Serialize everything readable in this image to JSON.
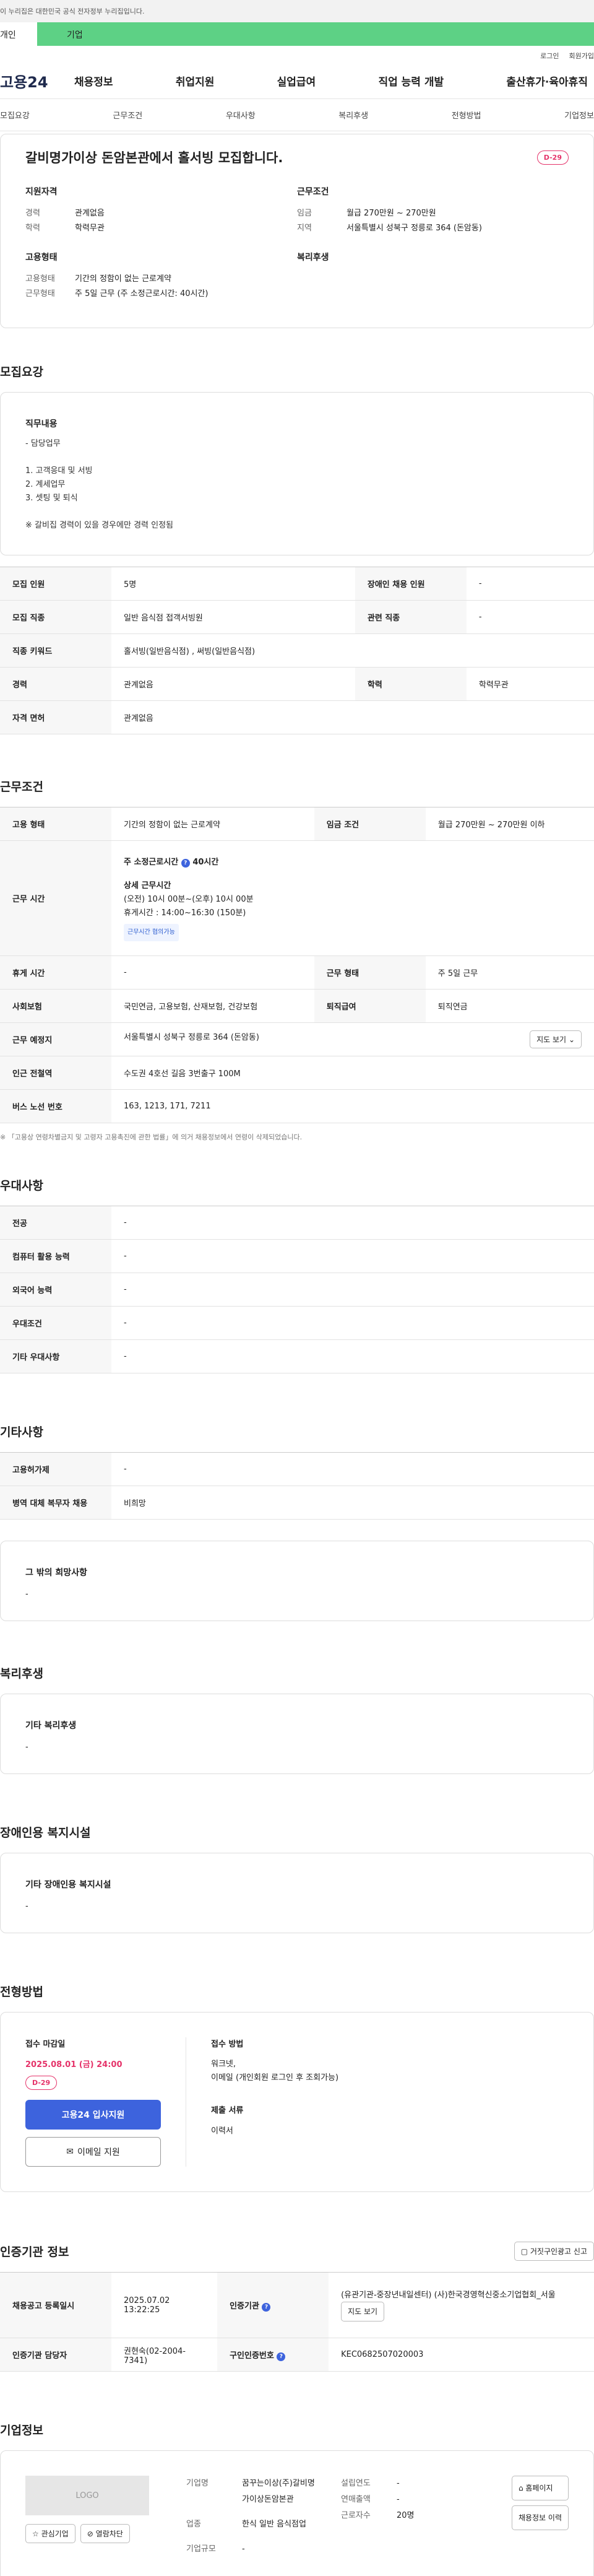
{
  "header": {
    "gov_banner": "이 누리집은 대한민국 공식 전자정부 누리집입니다.",
    "segment": [
      "개인",
      "기업"
    ],
    "util": [
      "로그인",
      "회원가입"
    ],
    "logo": "고용24",
    "gnb": [
      "채용정보",
      "취업지원",
      "실업급여",
      "직업 능력 개발",
      "출산휴가·육아휴직"
    ],
    "anchors": [
      "모집요강",
      "근무조건",
      "우대사항",
      "복리후생",
      "전형방법",
      "기업정보"
    ]
  },
  "summary": {
    "title": "갈비명가이상 돈암본관에서 홀서빙 모집합니다.",
    "dday": "D-29",
    "qual_head": "지원자격",
    "career_k": "경력",
    "career_v": "관계없음",
    "edu_k": "학력",
    "edu_v": "학력무관",
    "cond_head": "근무조건",
    "wage_k": "임금",
    "wage_v": "월급 270만원 ~ 270만원",
    "area_k": "지역",
    "area_v": "서울특별시 성북구 정릉로 364 (돈암동)",
    "emp_head": "고용형태",
    "emptype_k": "고용형태",
    "emptype_v": "기간의 정함이 없는 근로계약",
    "hours_k": "근무형태",
    "hours_v": "주 5일 근무 (주 소정근로시간: 40시간)",
    "welfare_head": "복리후생"
  },
  "recruit": {
    "title": "모집요강",
    "duty_head": "직무내용",
    "duty_lines": [
      "- 담당업무",
      "",
      "1. 고객응대 및 서빙",
      "2. 계세업무",
      "3. 셋팅 및 퇴식",
      "",
      "※ 갈비집 경력이 있을 경우에만 경력 인정됨"
    ],
    "rows": [
      {
        "k1": "모집 인원",
        "v1": "5명",
        "k2": "장애인 채용 인원",
        "v2": "-"
      },
      {
        "k1": "모집 직종",
        "v1": "일반 음식점 접객서빙원",
        "k2": "관련 직종",
        "v2": "-"
      },
      {
        "k1": "직종 키워드",
        "v1": "홀서빙(일반음식점) , 써빙(일반음식점)",
        "k2": "",
        "v2": ""
      },
      {
        "k1": "경력",
        "v1": "관계없음",
        "k2": "학력",
        "v2": "학력무관"
      },
      {
        "k1": "자격 면허",
        "v1": "관계없음",
        "k2": "",
        "v2": ""
      }
    ]
  },
  "work": {
    "title": "근무조건",
    "emp_k": "고용 형태",
    "emp_v": "기간의 정함이 없는 근로계약",
    "wage_k": "임금 조건",
    "wage_v": "월급 270만원 ~ 270만원 이하",
    "time_k": "근무 시간",
    "time_main": "주 소정근로시간",
    "time_hours": "40시간",
    "time_detail_head": "상세 근무시간",
    "time_detail_1": "(오전) 10시 00분~(오후) 10시 00분",
    "time_detail_2": "휴게시간 :  14:00~16:30 (150분)",
    "time_chip": "근무시간 협의가능",
    "rest_k": "휴게 시간",
    "rest_v": "-",
    "form_k": "근무 형태",
    "form_v": "주 5일 근무",
    "ins_k": "사회보험",
    "ins_v": "국민연금, 고용보험, 산재보험, 건강보험",
    "ret_k": "퇴직급여",
    "ret_v": "퇴직연금",
    "place_k": "근무 예정지",
    "place_v": "서울특별시 성북구 정릉로 364 (돈암동)",
    "map_btn": "지도 보기",
    "subway_k": "인근 전철역",
    "subway_v": "수도권 4호선 길음 3번출구 100M",
    "bus_k": "버스 노선 번호",
    "bus_v": "163, 1213, 171, 7211",
    "note": "※ 「고용상 연령차별금지 및 고령자 고용촉진에 관한 법률」에 의거 채용정보에서 연령이 삭제되었습니다."
  },
  "pref": {
    "title": "우대사항",
    "rows": [
      [
        "전공",
        "-"
      ],
      [
        "컴퓨터 활용 능력",
        "-"
      ],
      [
        "외국어 능력",
        "-"
      ],
      [
        "우대조건",
        "-"
      ],
      [
        "기타 우대사항",
        "-"
      ]
    ]
  },
  "etc": {
    "title": "기타사항",
    "rows": [
      [
        "고용허가제",
        "-"
      ],
      [
        "병역 대체 복무자 채용",
        "비희망"
      ]
    ],
    "box_head": "그 밖의 희망사항",
    "box_v": "-"
  },
  "welfare": {
    "title": "복리후생",
    "box_head": "기타 복리후생",
    "box_v": "-"
  },
  "disability": {
    "title": "장애인용 복지시설",
    "box_head": "기타 장애인용 복지시설",
    "box_v": "-"
  },
  "process": {
    "title": "전형방법",
    "deadline_head": "접수 마감일",
    "deadline": "2025.08.01 (금) 24:00",
    "dday": "D-29",
    "apply_btn": "고용24 입사지원",
    "email_btn": "이메일 지원",
    "method_head": "접수 방법",
    "method_v1": "워크넷,",
    "method_v2": "이메일 (개인회원 로그인 후 조회가능)",
    "docs_head": "제출 서류",
    "docs_v": "이력서"
  },
  "agency": {
    "title": "인증기관 정보",
    "report_btn": "거짓구인광고 신고",
    "reg_k": "채용공고 등록일시",
    "reg_v": "2025.07.02 13:22:25",
    "org_k": "인증기관",
    "org_v": "(유관기관-중장년내일센터) (사)한국경영혁신중소기업협회_서울",
    "org_btn": "지도 보기",
    "mgr_k": "인증기관 담당자",
    "mgr_v": "권현숙(02-2004-7341)",
    "num_k": "구인인증번호",
    "num_v": "KEC0682507020003"
  },
  "company": {
    "title": "기업정보",
    "logo": "LOGO",
    "fav_btn": "관심기업",
    "block_btn": "열람차단",
    "name_k": "기업명",
    "name_v": "꿈꾸는이상(주)갈비명가이상돈암본관",
    "ind_k": "업종",
    "ind_v": "한식 일반 음식점업",
    "size_k": "기업규모",
    "size_v": "-",
    "est_k": "설립연도",
    "est_v": "-",
    "sales_k": "연매출액",
    "sales_v": "-",
    "emp_k": "근로자수",
    "emp_v": "20명",
    "home_btn": "홈페이지",
    "list_btn": "채용정보 이력"
  }
}
